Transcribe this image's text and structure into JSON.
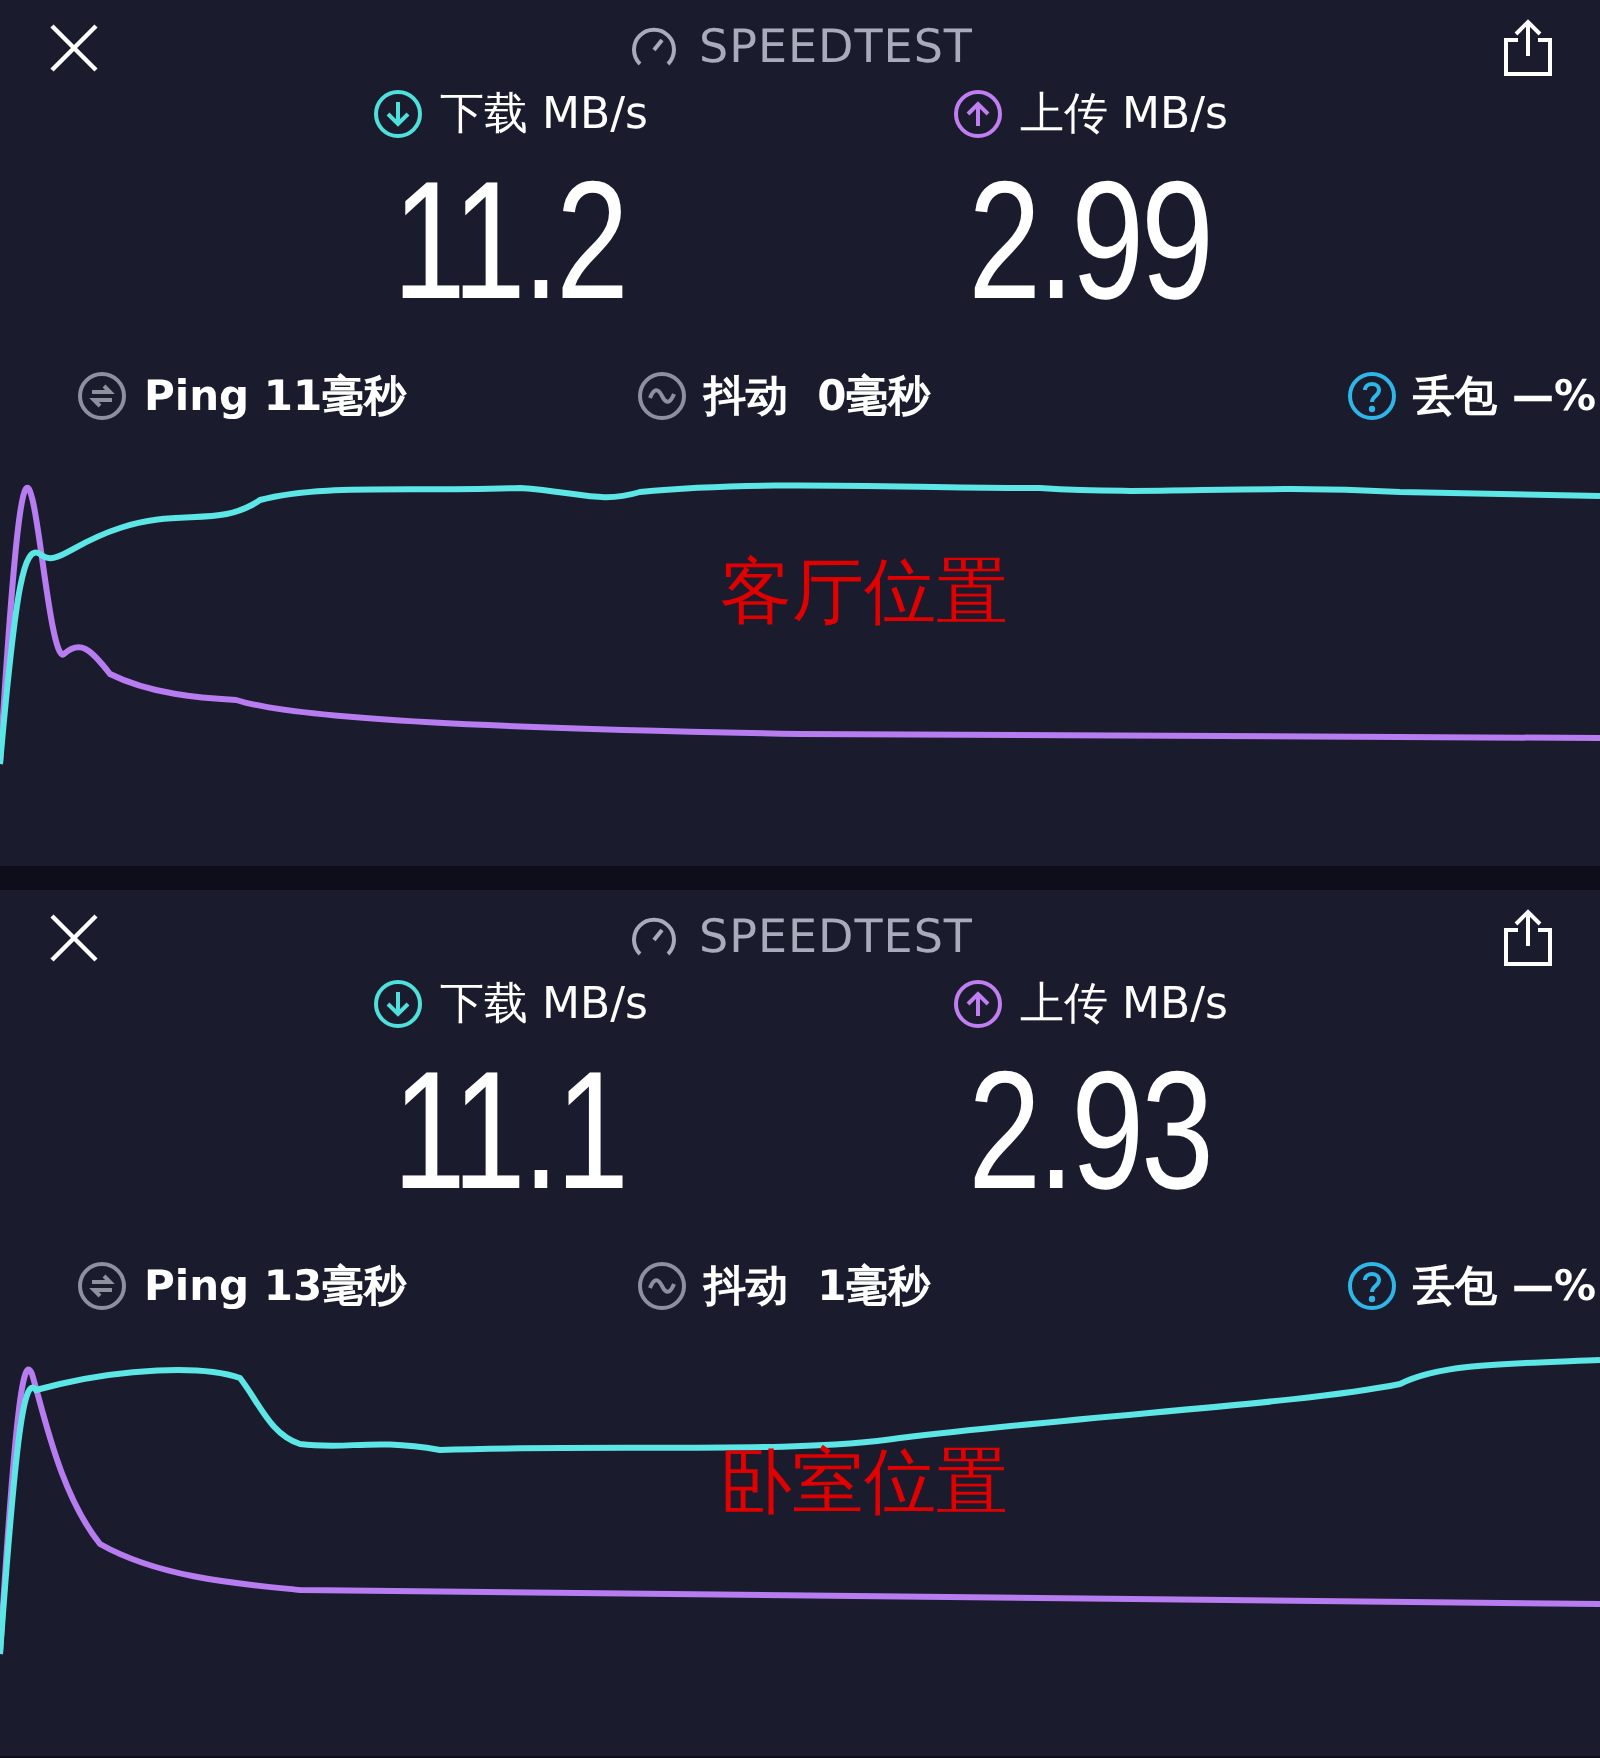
{
  "panels": [
    {
      "title": "SPEEDTEST",
      "download": {
        "label": "下载 MB/s",
        "value": "11.2"
      },
      "upload": {
        "label": "上传 MB/s",
        "value": "2.99"
      },
      "stats": [
        {
          "kind": "ping",
          "label": "Ping 11毫秒"
        },
        {
          "kind": "jitter",
          "label": "抖动  0毫秒"
        },
        {
          "kind": "loss",
          "label": "丢包 —%"
        }
      ],
      "caption": "客厅位置"
    },
    {
      "title": "SPEEDTEST",
      "download": {
        "label": "下载 MB/s",
        "value": "11.1"
      },
      "upload": {
        "label": "上传 MB/s",
        "value": "2.93"
      },
      "stats": [
        {
          "kind": "ping",
          "label": "Ping 13毫秒"
        },
        {
          "kind": "jitter",
          "label": "抖动  1毫秒"
        },
        {
          "kind": "loss",
          "label": "丢包 —%"
        }
      ],
      "caption": "卧室位置"
    }
  ]
}
